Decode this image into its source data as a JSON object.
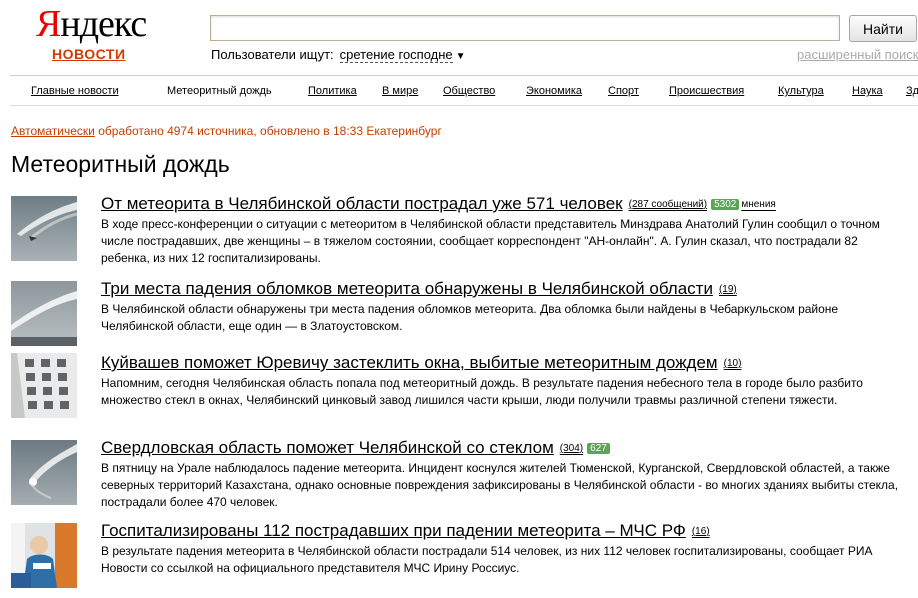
{
  "logo": {
    "ya": "Я",
    "rest": "ндекс",
    "sub": "НОВОСТИ"
  },
  "search": {
    "value": "",
    "placeholder": "",
    "button_label": "Найти"
  },
  "users_search": {
    "label": "Пользователи ищут:",
    "query": "сретение господне",
    "arrow": "▼"
  },
  "advanced_search": "расширенный поиск",
  "nav": {
    "items": [
      {
        "label": "Главные новости",
        "current": false
      },
      {
        "label": "Метеоритный дождь",
        "current": true
      },
      {
        "label": "Политика",
        "current": false
      },
      {
        "label": "В мире",
        "current": false
      },
      {
        "label": "Общество",
        "current": false
      },
      {
        "label": "Экономика",
        "current": false
      },
      {
        "label": "Спорт",
        "current": false
      },
      {
        "label": "Происшествия",
        "current": false
      },
      {
        "label": "Культура",
        "current": false
      },
      {
        "label": "Наука",
        "current": false
      },
      {
        "label": "Здо",
        "current": false
      }
    ]
  },
  "status": {
    "auto": "Автоматически",
    "text": " обработано 4974 источника, обновлено в 18:33 Екатеринбург"
  },
  "page_title": "Метеоритный дождь",
  "items": [
    {
      "title": "От метеорита в Челябинской области пострадал уже 571 человек",
      "count": "(287 сообщений)",
      "badge": "5302",
      "badge_label": "мнения",
      "text": "В ходе пресс-конференции о ситуации с метеоритом в Челябинской области представитель Минздрава Анатолий Гулин сообщил о точном числе пострадавших, две женщины – в тяжелом состоянии, сообщает корреспондент \"АН-онлайн\". А. Гулин сказал, что пострадали 82 ребенка, из них 12 госпитализированы."
    },
    {
      "title": "Три места падения обломков метеорита обнаружены в Челябинской области",
      "count": "(19)",
      "badge": "",
      "badge_label": "",
      "text": "В Челябинской области обнаружены три места падения обломков метеорита. Два обломка были найдены в Чебаркульском районе Челябинской области, еще один — в Златоустовском."
    },
    {
      "title": "Куйвашев поможет Юревичу застеклить окна, выбитые метеоритным дождем",
      "count": "(10)",
      "badge": "",
      "badge_label": "",
      "text": "Напомним, сегодня Челябинская область попала под метеоритный дождь. В результате падения небесного тела в городе было разбито множество стекл в окнах, Челябинский цинковый завод лишился части крыши, люди получили травмы различной степени тяжести."
    },
    {
      "title": "Свердловская область поможет Челябинской со стеклом",
      "count": "(304)",
      "badge": "627",
      "badge_label": "",
      "text": "В пятницу на Урале наблюдалось падение метеорита. Инцидент коснулся жителей Тюменской, Курганской, Свердловской областей, а также северных территорий Казахстана, однако основные повреждения зафиксированы в Челябинской области - во многих зданиях выбиты стекла, пострадали более 470 человек."
    },
    {
      "title": "Госпитализированы 112 пострадавших при падении метеорита – МЧС РФ",
      "count": "(16)",
      "badge": "",
      "badge_label": "",
      "text": "В результате падения метеорита в Челябинской области пострадали 514 человек, из них 112 человек госпитализированы, сообщает РИА Новости со ссылкой на официального представителя МЧС Ирину Россиус."
    }
  ]
}
